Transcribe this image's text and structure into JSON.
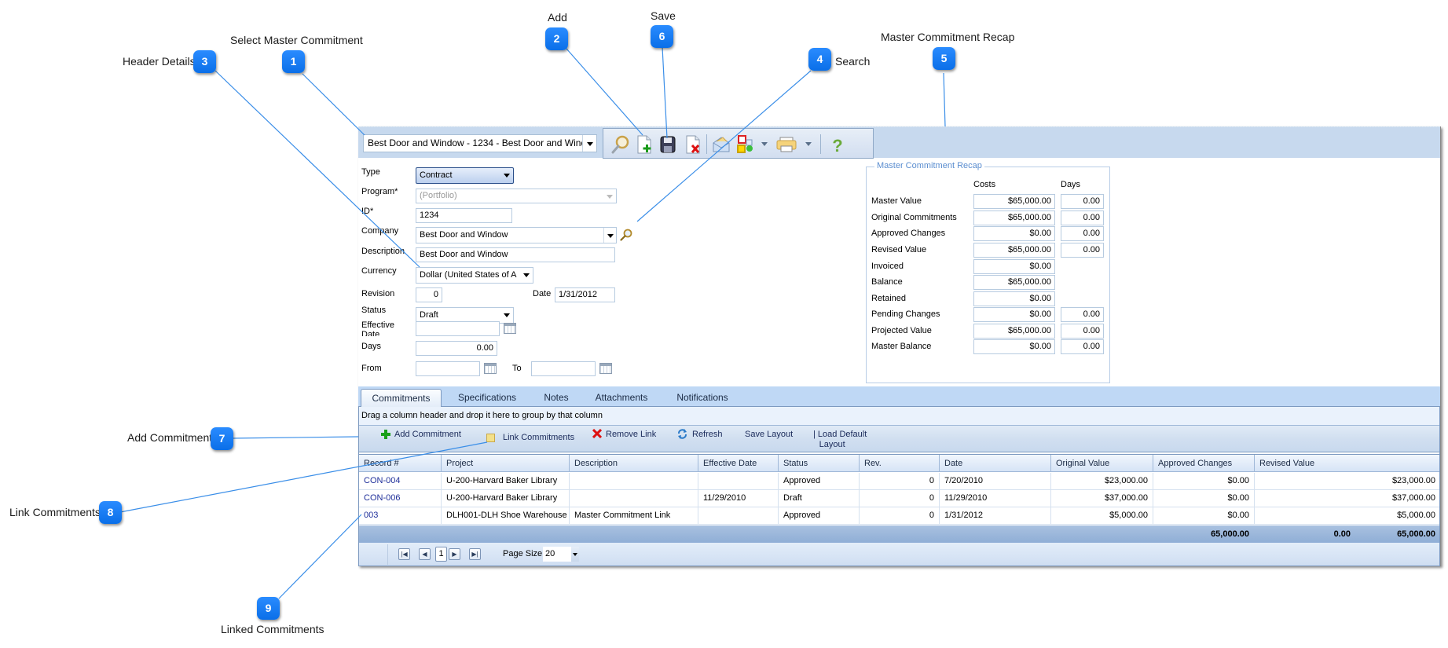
{
  "callouts": [
    {
      "number": "1",
      "label": "Select Master Commitment"
    },
    {
      "number": "2",
      "label": "Add"
    },
    {
      "number": "3",
      "label": "Header Details"
    },
    {
      "number": "4",
      "label": "Search"
    },
    {
      "number": "5",
      "label": "Master Commitment Recap"
    },
    {
      "number": "6",
      "label": "Save"
    },
    {
      "number": "7",
      "label": "Add Commitment"
    },
    {
      "number": "8",
      "label": "Link Commitments"
    },
    {
      "number": "9",
      "label": "Linked Commitments"
    }
  ],
  "header": {
    "master_commitment_selected": "Best Door and Window - 1234 - Best Door and Window",
    "toolbar_icons": [
      "search-icon",
      "add-document-icon",
      "save-icon",
      "delete-document-icon",
      "email-icon",
      "workflow-icon",
      "print-icon",
      "help-icon"
    ]
  },
  "form": {
    "type": {
      "label": "Type",
      "value": "Contract"
    },
    "program": {
      "label": "Program*",
      "value": "(Portfolio)"
    },
    "id": {
      "label": "ID*",
      "value": "1234"
    },
    "company": {
      "label": "Company",
      "value": "Best Door and Window"
    },
    "description": {
      "label": "Description",
      "value": "Best Door and Window"
    },
    "currency": {
      "label": "Currency",
      "value": "Dollar (United States of A"
    },
    "revision": {
      "label": "Revision",
      "value": "0"
    },
    "date": {
      "label": "Date",
      "value": "1/31/2012"
    },
    "status": {
      "label": "Status",
      "value": "Draft"
    },
    "effective_date": {
      "label_line1": "Effective",
      "label_line2": "Date",
      "value": ""
    },
    "days": {
      "label": "Days",
      "value": "0.00"
    },
    "from": {
      "label": "From",
      "value": ""
    },
    "to": {
      "label": "To",
      "value": ""
    }
  },
  "recap": {
    "title": "Master Commitment Recap",
    "col_costs": "Costs",
    "col_days": "Days",
    "rows": [
      {
        "label": "Master Value",
        "cost": "$65,000.00",
        "days": "0.00"
      },
      {
        "label": "Original Commitments",
        "cost": "$65,000.00",
        "days": "0.00"
      },
      {
        "label": "Approved Changes",
        "cost": "$0.00",
        "days": "0.00"
      },
      {
        "label": "Revised Value",
        "cost": "$65,000.00",
        "days": "0.00"
      },
      {
        "label": "Invoiced",
        "cost": "$0.00",
        "days": null
      },
      {
        "label": "Balance",
        "cost": "$65,000.00",
        "days": null
      },
      {
        "label": "Retained",
        "cost": "$0.00",
        "days": null
      },
      {
        "label": "Pending Changes",
        "cost": "$0.00",
        "days": "0.00"
      },
      {
        "label": "Projected Value",
        "cost": "$65,000.00",
        "days": "0.00"
      },
      {
        "label": "Master Balance",
        "cost": "$0.00",
        "days": "0.00"
      }
    ]
  },
  "tabs": [
    {
      "label": "Commitments",
      "active": true
    },
    {
      "label": "Specifications",
      "active": false
    },
    {
      "label": "Notes",
      "active": false
    },
    {
      "label": "Attachments",
      "active": false
    },
    {
      "label": "Notifications",
      "active": false
    }
  ],
  "grid": {
    "group_hint": "Drag a column header and drop it here to group by that column",
    "toolbar": {
      "add_commitment": "Add Commitment",
      "link_commitments": "Link Commitments",
      "remove_link": "Remove Link",
      "refresh": "Refresh",
      "save_layout": "Save Layout",
      "load_default_line1": "| Load Default",
      "load_default_line2": "Layout"
    },
    "columns": [
      "Record #",
      "Project",
      "Description",
      "Effective Date",
      "Status",
      "Rev.",
      "Date",
      "Original Value",
      "Approved Changes",
      "Revised Value"
    ],
    "rows": [
      {
        "record": "CON-004",
        "project": "U-200-Harvard Baker Library",
        "description": "",
        "effective_date": "",
        "status": "Approved",
        "rev": "0",
        "date": "7/20/2010",
        "original_value": "$23,000.00",
        "approved_changes": "$0.00",
        "revised_value": "$23,000.00"
      },
      {
        "record": "CON-006",
        "project": "U-200-Harvard Baker Library",
        "description": "",
        "effective_date": "11/29/2010",
        "status": "Draft",
        "rev": "0",
        "date": "11/29/2010",
        "original_value": "$37,000.00",
        "approved_changes": "$0.00",
        "revised_value": "$37,000.00"
      },
      {
        "record": "003",
        "project": "DLH001-DLH Shoe Warehouse",
        "description": "Master Commitment Link",
        "effective_date": "",
        "status": "Approved",
        "rev": "0",
        "date": "1/31/2012",
        "original_value": "$5,000.00",
        "approved_changes": "$0.00",
        "revised_value": "$5,000.00"
      }
    ],
    "totals": {
      "original_value": "65,000.00",
      "approved_changes": "0.00",
      "revised_value": "65,000.00"
    },
    "pager": {
      "current_page": "1",
      "page_size_label": "Page Size",
      "page_size": "20"
    }
  }
}
